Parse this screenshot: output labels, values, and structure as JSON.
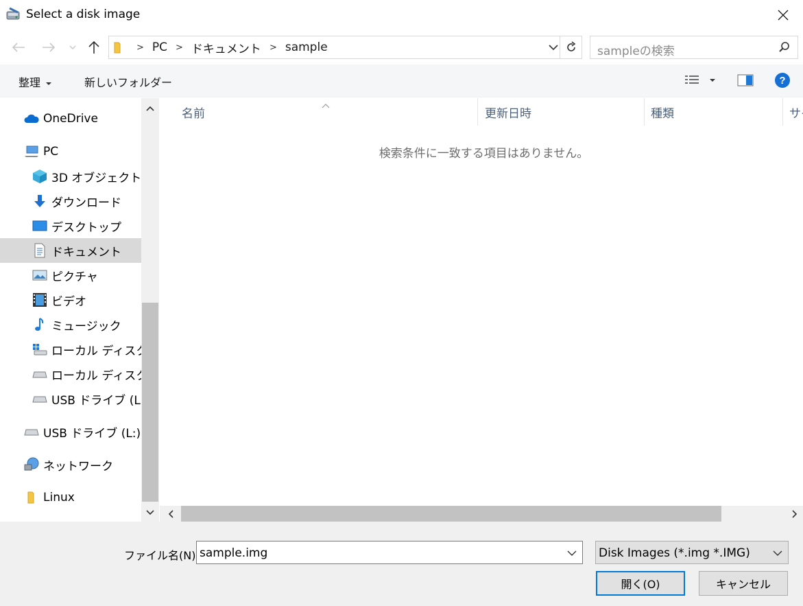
{
  "window": {
    "title": "Select a disk image"
  },
  "address": {
    "crumbs": [
      "PC",
      "ドキュメント",
      "sample"
    ]
  },
  "search": {
    "placeholder": "sampleの検索"
  },
  "toolbar": {
    "organize": "整理",
    "new_folder": "新しいフォルダー"
  },
  "sidebar": {
    "items": [
      {
        "label": "OneDrive",
        "icon": "cloud-icon"
      },
      {
        "label": "PC",
        "icon": "computer-icon"
      },
      {
        "label": "3D オブジェクト",
        "icon": "cube-icon"
      },
      {
        "label": "ダウンロード",
        "icon": "download-arrow-icon"
      },
      {
        "label": "デスクトップ",
        "icon": "desktop-icon"
      },
      {
        "label": "ドキュメント",
        "icon": "document-icon",
        "selected": true
      },
      {
        "label": "ピクチャ",
        "icon": "picture-icon"
      },
      {
        "label": "ビデオ",
        "icon": "video-icon"
      },
      {
        "label": "ミュージック",
        "icon": "music-note-icon"
      },
      {
        "label": "ローカル ディスク (C:)",
        "icon": "windows-drive-icon"
      },
      {
        "label": "ローカル ディスク (D:)",
        "icon": "drive-icon"
      },
      {
        "label": "USB ドライブ (L:)",
        "icon": "usb-drive-icon"
      },
      {
        "label": "USB ドライブ (L:)",
        "icon": "usb-drive-icon"
      },
      {
        "label": "ネットワーク",
        "icon": "network-icon"
      },
      {
        "label": "Linux",
        "icon": "folder-icon"
      }
    ]
  },
  "file_list": {
    "columns": [
      "名前",
      "更新日時",
      "種類",
      "サイズ"
    ],
    "empty_message": "検索条件に一致する項目はありません。"
  },
  "bottom": {
    "filename_label": "ファイル名(N):",
    "filename_value": "sample.img",
    "filter_value": "Disk Images (*.img *.IMG)",
    "open_label": "開く(O)",
    "cancel_label": "キャンセル"
  },
  "colors": {
    "accent": "#0078d7",
    "selected_bg": "#d9d9d9",
    "header_text": "#4c607a"
  }
}
